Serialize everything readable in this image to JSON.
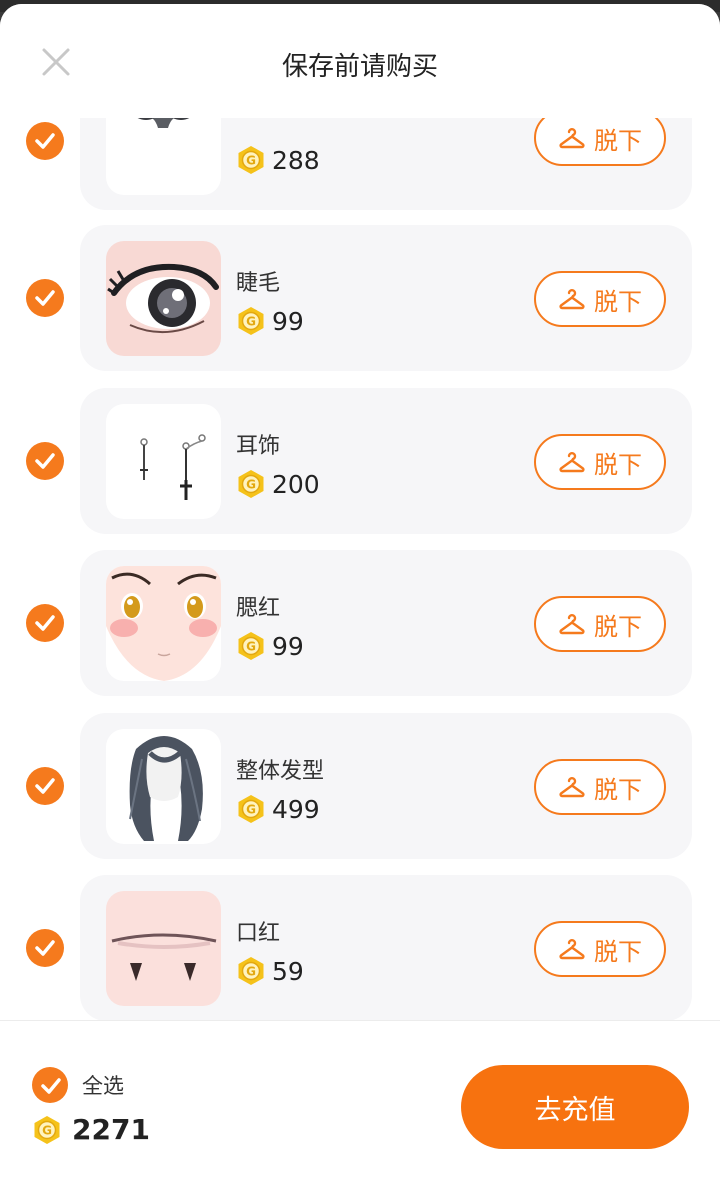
{
  "header": {
    "title": "保存前请购买"
  },
  "items": [
    {
      "name": "",
      "price": "288",
      "remove_label": "脱下",
      "checked": true,
      "thumb": "jeans-shorts"
    },
    {
      "name": "睫毛",
      "price": "99",
      "remove_label": "脱下",
      "checked": true,
      "thumb": "eyelashes"
    },
    {
      "name": "耳饰",
      "price": "200",
      "remove_label": "脱下",
      "checked": true,
      "thumb": "earrings"
    },
    {
      "name": "腮红",
      "price": "99",
      "remove_label": "脱下",
      "checked": true,
      "thumb": "blush-face"
    },
    {
      "name": "整体发型",
      "price": "499",
      "remove_label": "脱下",
      "checked": true,
      "thumb": "hairstyle"
    },
    {
      "name": "口红",
      "price": "59",
      "remove_label": "脱下",
      "checked": true,
      "thumb": "lipstick"
    }
  ],
  "footer": {
    "select_all_label": "全选",
    "select_all_checked": true,
    "total": "2271",
    "recharge_label": "去充值"
  },
  "colors": {
    "accent": "#f57a1d",
    "coin": "#f5c21a",
    "card_bg": "#f6f6f8"
  },
  "icons": [
    "close-icon",
    "check-icon",
    "coin-icon",
    "hanger-icon"
  ]
}
